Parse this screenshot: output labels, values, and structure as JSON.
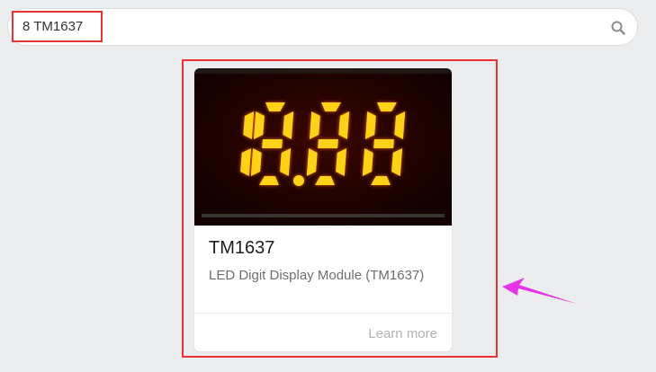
{
  "search": {
    "value": "8 TM1637"
  },
  "card": {
    "display_digits": "18.88",
    "title": "TM1637",
    "description": "LED Digit Display Module (TM1637)",
    "learn_more": "Learn more"
  },
  "icons": {
    "search": "search-icon"
  },
  "colors": {
    "highlight": "#e53333",
    "arrow": "#e633e6",
    "segment_on": "#ffd21a",
    "display_bg": "#1a0200"
  }
}
